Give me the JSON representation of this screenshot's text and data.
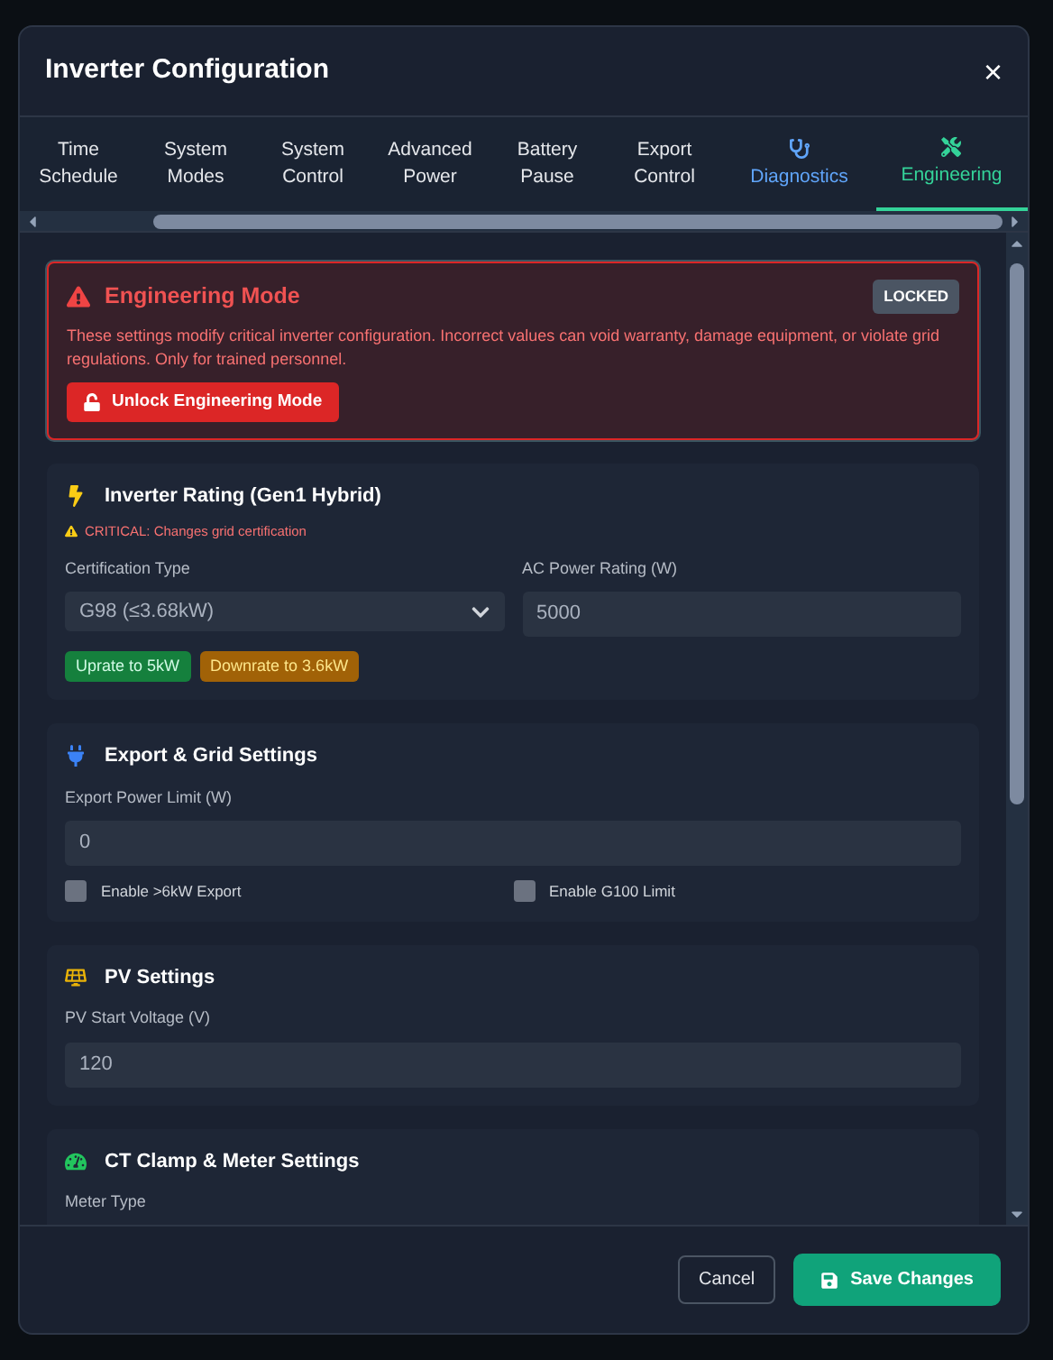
{
  "dialog": {
    "title": "Inverter Configuration",
    "close": "×"
  },
  "tabs": [
    {
      "line1": "Time",
      "line2": "Schedule",
      "kind": "text",
      "selected": false
    },
    {
      "line1": "System",
      "line2": "Modes",
      "kind": "text",
      "selected": false
    },
    {
      "line1": "System",
      "line2": "Control",
      "kind": "text",
      "selected": false
    },
    {
      "line1": "Advanced",
      "line2": "Power",
      "kind": "text",
      "selected": false
    },
    {
      "line1": "Battery",
      "line2": "Pause",
      "kind": "text",
      "selected": false
    },
    {
      "line1": "Export",
      "line2": "Control",
      "kind": "text",
      "selected": false
    },
    {
      "line2": "Diagnostics",
      "kind": "stethoscope",
      "selected": false
    },
    {
      "line2": "Engineering",
      "kind": "tools",
      "selected": true
    }
  ],
  "alert": {
    "title": "Engineering Mode",
    "badge": "LOCKED",
    "message": "These settings modify critical inverter configuration. Incorrect values can void warranty, damage equipment, or violate grid regulations. Only for trained personnel.",
    "button": "Unlock Engineering Mode"
  },
  "sections": [
    {
      "kind": "bolt",
      "title": "Inverter Rating (Gen1 Hybrid)",
      "warning": "CRITICAL: Changes grid certification",
      "fields": [
        {
          "kind": "select",
          "label": "Certification Type",
          "value": "G98 (≤3.68kW)"
        },
        {
          "kind": "input",
          "label": "AC Power Rating (W)",
          "value": "5000"
        }
      ],
      "buttons": [
        {
          "label": "Uprate to 5kW",
          "kind": "uprate"
        },
        {
          "label": "Downrate to 3.6kW",
          "kind": "downrate"
        }
      ]
    },
    {
      "kind": "plug",
      "title": "Export & Grid Settings",
      "fields": [
        {
          "kind": "input",
          "label": "Export Power Limit (W)",
          "value": "0"
        }
      ],
      "checkboxes": [
        {
          "label": "Enable >6kW Export",
          "checked": false
        },
        {
          "label": "Enable G100 Limit",
          "checked": false
        }
      ]
    },
    {
      "kind": "solar",
      "title": "PV Settings",
      "fields": [
        {
          "kind": "input",
          "label": "PV Start Voltage (V)",
          "value": "120"
        }
      ]
    },
    {
      "kind": "gauge",
      "title": "CT Clamp & Meter Settings",
      "fields": [
        {
          "kind": "label",
          "label": "Meter Type"
        }
      ]
    }
  ],
  "footer": {
    "cancel": "Cancel",
    "save": "Save Changes"
  }
}
